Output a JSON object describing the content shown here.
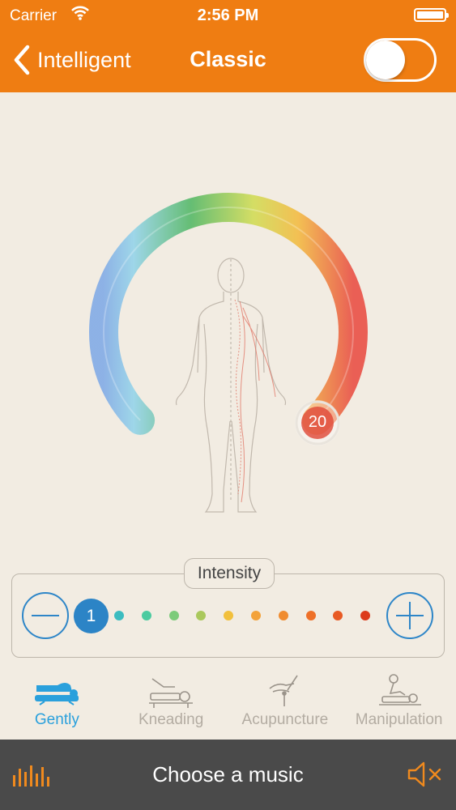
{
  "status_bar": {
    "carrier": "Carrier",
    "time": "2:56 PM"
  },
  "nav": {
    "back_label": "Intelligent",
    "title": "Classic",
    "toggle_on": false
  },
  "dial": {
    "value": "20",
    "gradient": [
      "#6f9ee0",
      "#7ecde0",
      "#3fb25a",
      "#d8dc4a",
      "#f2b733",
      "#e8423a"
    ]
  },
  "intensity": {
    "label": "Intensity",
    "current": "1",
    "levels": 11,
    "dot_colors": [
      "#3cbcc0",
      "#4ccba0",
      "#7ccb7a",
      "#aac85c",
      "#f2c03c",
      "#f3a23a",
      "#f08c30",
      "#ee7028",
      "#e85a24",
      "#dc3b1c"
    ]
  },
  "modes": [
    {
      "label": "Gently",
      "icon": "lying-massage-icon",
      "active": true
    },
    {
      "label": "Kneading",
      "icon": "kneading-icon",
      "active": false
    },
    {
      "label": "Acupuncture",
      "icon": "acupuncture-icon",
      "active": false
    },
    {
      "label": "Manipulation",
      "icon": "manipulation-icon",
      "active": false
    }
  ],
  "music": {
    "label": "Choose a music",
    "icon_color": "#f08a1e"
  },
  "colors": {
    "accent": "#ef7d12",
    "blue": "#2c84c6",
    "background": "#f2ece2"
  }
}
